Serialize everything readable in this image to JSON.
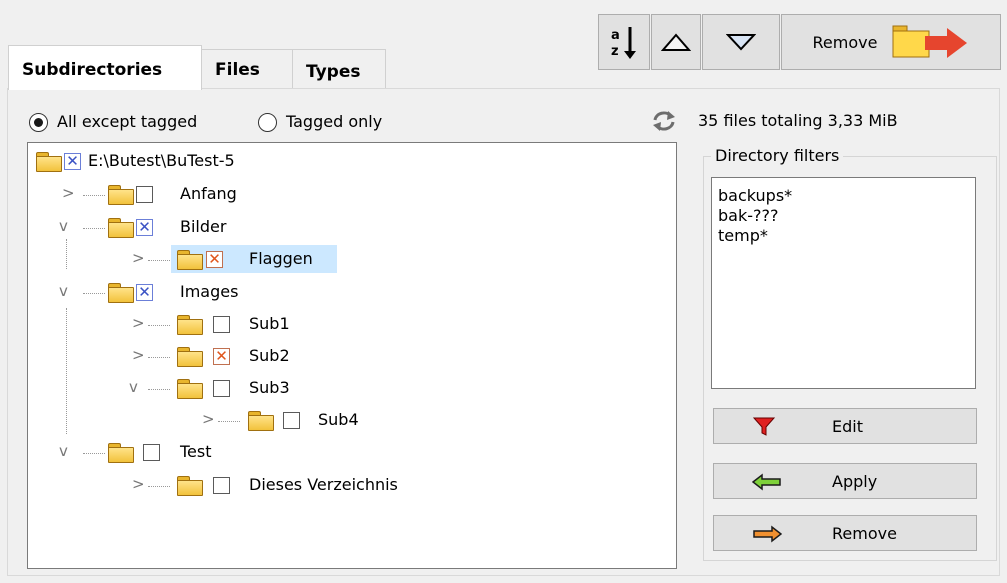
{
  "toolbar": {
    "sort_icon": "sort-az-icon",
    "up_icon": "triangle-up-icon",
    "down_icon": "triangle-down-icon",
    "remove_label": "Remove"
  },
  "tabs": [
    {
      "label": "Subdirectories",
      "active": true
    },
    {
      "label": "Files",
      "active": false
    },
    {
      "label": "Types",
      "active": false
    }
  ],
  "filter_mode": {
    "options": [
      {
        "label": "All except tagged",
        "checked": true
      },
      {
        "label": "Tagged only",
        "checked": false
      }
    ]
  },
  "status": {
    "refresh_icon": "refresh-icon",
    "text": "35 files totaling 3,33 MiB"
  },
  "tree": {
    "root": {
      "label": "E:\\Butest\\BuTest-5",
      "tag": "blue"
    },
    "nodes": [
      {
        "label": "Anfang",
        "tag": "none",
        "expanded": false
      },
      {
        "label": "Bilder",
        "tag": "blue",
        "expanded": true
      },
      {
        "label": "Flaggen",
        "tag": "orange",
        "expanded": false,
        "selected": true
      },
      {
        "label": "Images",
        "tag": "blue",
        "expanded": true
      },
      {
        "label": "Sub1",
        "tag": "none",
        "expanded": false
      },
      {
        "label": "Sub2",
        "tag": "orange",
        "expanded": false
      },
      {
        "label": "Sub3",
        "tag": "none",
        "expanded": true
      },
      {
        "label": "Sub4",
        "tag": "none",
        "expanded": false
      },
      {
        "label": "Test",
        "tag": "none",
        "expanded": true
      },
      {
        "label": "Dieses Verzeichnis",
        "tag": "none",
        "expanded": false
      }
    ]
  },
  "directory_filters": {
    "legend": "Directory filters",
    "items": [
      "backups*",
      "bak-???",
      "temp*"
    ],
    "buttons": [
      {
        "label": "Edit",
        "icon": "funnel-icon"
      },
      {
        "label": "Apply",
        "icon": "arrow-left-green-icon"
      },
      {
        "label": "Remove",
        "icon": "arrow-right-orange-icon"
      }
    ]
  },
  "colors": {
    "tag_blue": "#3a52c4",
    "tag_orange": "#e0551b",
    "selection": "#cce8ff"
  }
}
